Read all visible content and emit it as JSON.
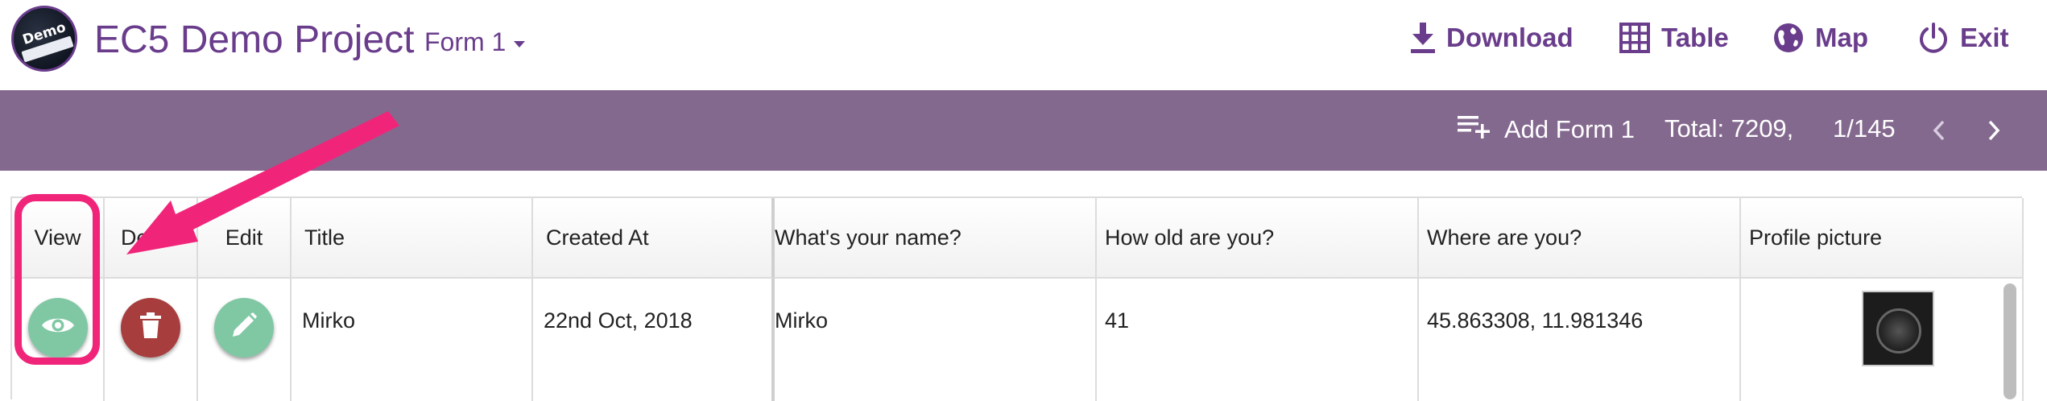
{
  "header": {
    "logo_text": "Demo",
    "project_title": "EC5 Demo Project",
    "form_selector": "Form 1",
    "nav": {
      "download": "Download",
      "table": "Table",
      "map": "Map",
      "exit": "Exit"
    }
  },
  "toolbar": {
    "add_form_label": "Add Form 1",
    "total_label": "Total: 7209,",
    "page_label": "1/145"
  },
  "table": {
    "columns": [
      "View",
      "Delete",
      "Edit",
      "Title",
      "Created At",
      "What's your name?",
      "How old are you?",
      "Where are you?",
      "Profile picture"
    ],
    "visible_header_text": {
      "view": "View",
      "delete": "De",
      "edit": "Edit",
      "title": "Title",
      "created_at": "Created At",
      "name": "What's your name?",
      "age": "How old are you?",
      "location": "Where are you?",
      "profile": "Profile picture"
    },
    "rows": [
      {
        "title": "Mirko",
        "created_at": "22nd Oct, 2018",
        "name": "Mirko",
        "age": "41",
        "location": "45.863308, 11.981346"
      }
    ]
  },
  "colors": {
    "brand": "#6a3d8c",
    "toolbar_bg": "#84698f",
    "view_button": "#80c8a4",
    "delete_button": "#a83d3d",
    "edit_button": "#80c8a4",
    "annotation": "#f0257a"
  },
  "icons": {
    "download": "download-icon",
    "table": "grid-icon",
    "map": "globe-icon",
    "exit": "power-icon",
    "add": "playlist-add-icon",
    "prev": "chevron-left-icon",
    "next": "chevron-right-icon",
    "view": "eye-icon",
    "delete": "trash-icon",
    "edit": "pencil-icon"
  }
}
